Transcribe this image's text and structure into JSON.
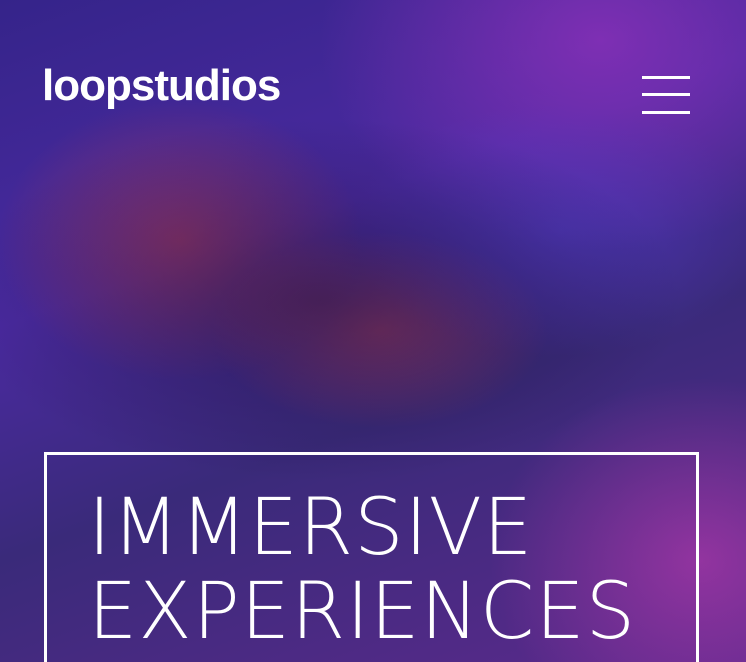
{
  "header": {
    "logo_text": "loopstudios",
    "menu_icon": "hamburger-menu-icon"
  },
  "hero": {
    "headline_line1": "IMMERSIVE",
    "headline_line2": "EXPERIENCES"
  },
  "colors": {
    "text": "#ffffff",
    "accent_purple": "#4a2aa0",
    "accent_magenta": "#c03cb4",
    "accent_red": "#be3c46"
  }
}
